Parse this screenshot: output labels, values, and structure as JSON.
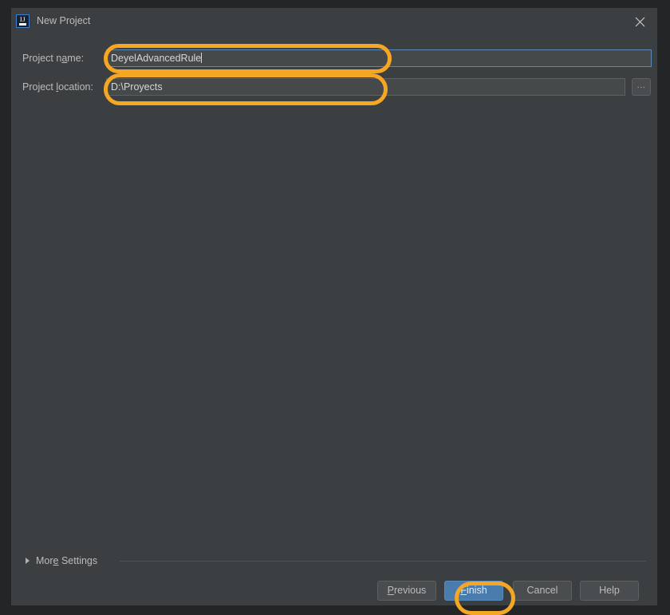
{
  "window": {
    "title": "New Project",
    "app_icon": "intellij-idea-icon",
    "icon_text": "IJ",
    "close_icon": "close-icon"
  },
  "form": {
    "name_field": {
      "label_before": "Project n",
      "label_mnemonic": "a",
      "label_after": "me:",
      "label_full": "Project name:",
      "value": "DeyelAdvancedRule",
      "placeholder": "",
      "focused": true
    },
    "location_field": {
      "label_before": "Project ",
      "label_mnemonic": "l",
      "label_after": "ocation:",
      "label_full": "Project location:",
      "value": "D:\\Proyects",
      "placeholder": "",
      "focused": false
    },
    "browse_button": {
      "label": "...",
      "icon": "ellipsis-icon"
    }
  },
  "more_settings": {
    "label_before": "Mor",
    "label_mnemonic": "e",
    "label_after": " Settings",
    "label_full": "More Settings",
    "expanded": false,
    "chevron_icon": "triangle-right-icon"
  },
  "buttons": {
    "previous": {
      "label_before": "",
      "label_mnemonic": "P",
      "label_after": "revious",
      "label_full": "Previous",
      "default": false
    },
    "finish": {
      "label_before": "",
      "label_mnemonic": "F",
      "label_after": "inish",
      "label_full": "Finish",
      "default": true
    },
    "cancel": {
      "label_before": "Cancel",
      "label_mnemonic": "",
      "label_after": "",
      "label_full": "Cancel",
      "default": false
    },
    "help": {
      "label_before": "Help",
      "label_mnemonic": "",
      "label_after": "",
      "label_full": "Help",
      "default": false
    }
  },
  "annotations": [
    {
      "name": "highlight-project-name-field",
      "shape": "rounded-rect",
      "color": "#f5a623"
    },
    {
      "name": "highlight-project-location-field",
      "shape": "rounded-rect",
      "color": "#f5a623"
    },
    {
      "name": "highlight-finish-button",
      "shape": "rounded-rect",
      "color": "#f5a623"
    }
  ],
  "colors": {
    "dialog_background": "#3c3f41",
    "frame_background": "#232527",
    "field_background": "#45494a",
    "focus_border": "#5b87b4",
    "default_button": "#4a7bad",
    "annotation": "#f5a623",
    "label_text": "#bbbbbb"
  }
}
